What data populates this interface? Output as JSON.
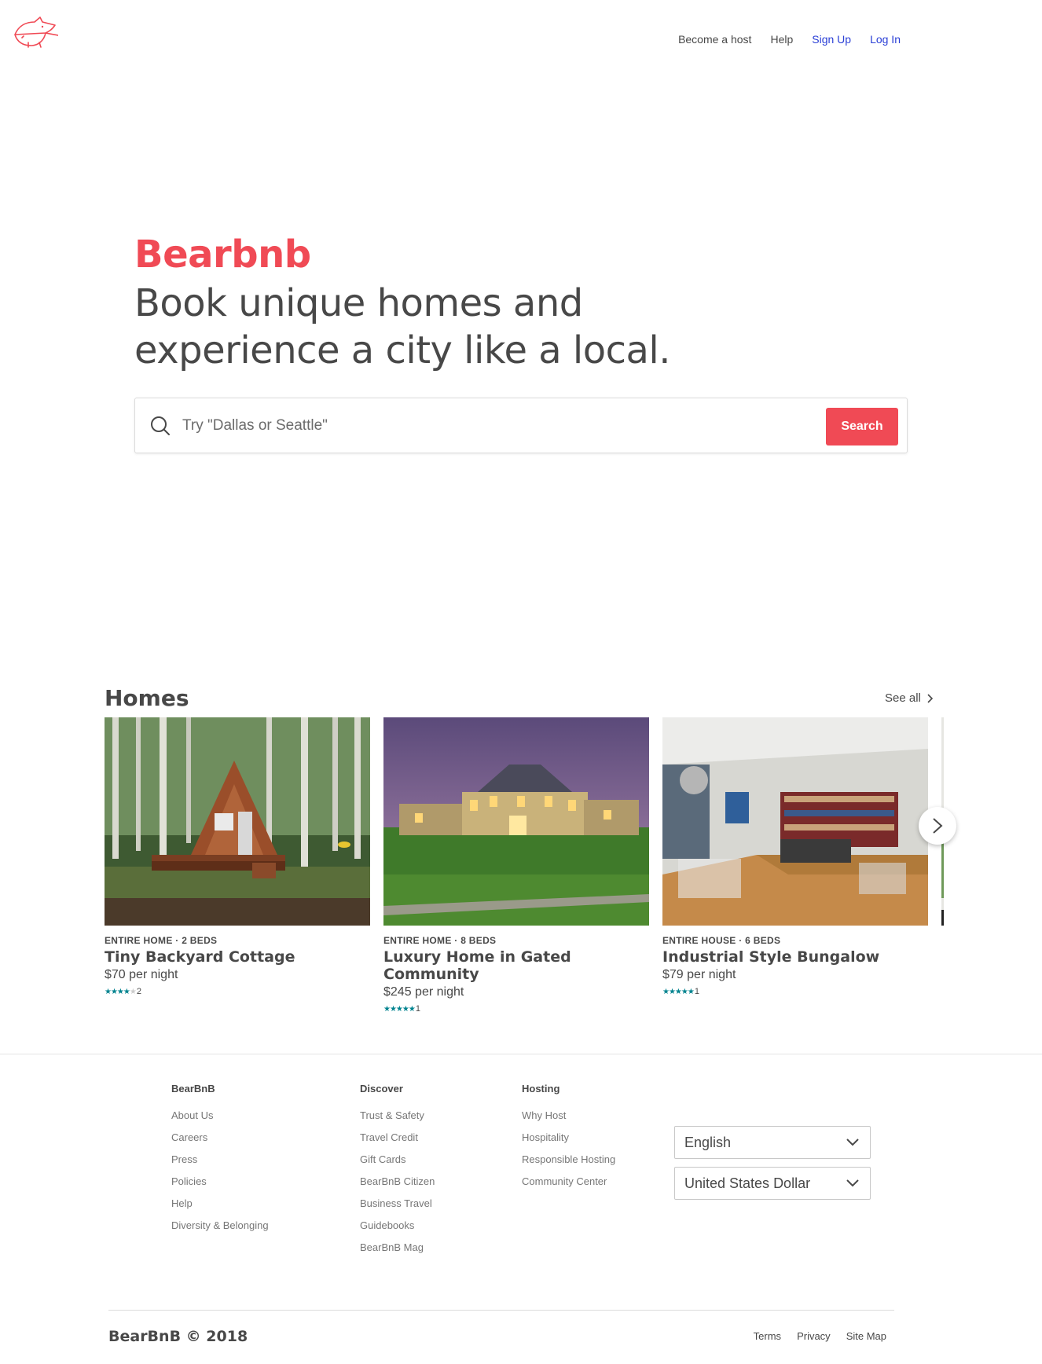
{
  "header": {
    "nav": {
      "become_host": "Become a host",
      "help": "Help",
      "sign_up": "Sign Up",
      "log_in": "Log In"
    }
  },
  "hero": {
    "brand": "Bearbnb",
    "tagline": "Book unique homes and experience a city like a local.",
    "search_placeholder": "Try \"Dallas or Seattle\"",
    "search_button": "Search"
  },
  "homes": {
    "title": "Homes",
    "see_all": "See all",
    "cards": [
      {
        "meta": "ENTIRE HOME · 2 BEDS",
        "title": "Tiny Backyard Cottage",
        "price": "$70 per night",
        "stars": 4,
        "reviews": "2"
      },
      {
        "meta": "ENTIRE HOME · 8 BEDS",
        "title": "Luxury Home in Gated Community",
        "price": "$245 per night",
        "stars": 5,
        "reviews": "1"
      },
      {
        "meta": "ENTIRE HOUSE · 6 BEDS",
        "title": "Industrial Style Bungalow",
        "price": "$79 per night",
        "stars": 5,
        "reviews": "1"
      }
    ]
  },
  "footer": {
    "col1": {
      "heading": "BearBnB",
      "links": [
        "About Us",
        "Careers",
        "Press",
        "Policies",
        "Help",
        "Diversity & Belonging"
      ]
    },
    "col2": {
      "heading": "Discover",
      "links": [
        "Trust & Safety",
        "Travel Credit",
        "Gift Cards",
        "BearBnB Citizen",
        "Business Travel",
        "Guidebooks",
        "BearBnB Mag"
      ]
    },
    "col3": {
      "heading": "Hosting",
      "links": [
        "Why Host",
        "Hospitality",
        "Responsible Hosting",
        "Community Center"
      ]
    },
    "language": "English",
    "currency": "United States Dollar",
    "copyright": "BearBnB © 2018",
    "legal": {
      "terms": "Terms",
      "privacy": "Privacy",
      "sitemap": "Site Map"
    }
  },
  "colors": {
    "brand": "#f04a55",
    "link_blue": "#2a3fd6",
    "star_teal": "#00838f"
  },
  "icons": [
    "bear-logo-icon",
    "search-icon",
    "chevron-right-icon",
    "chevron-down-icon",
    "star-icon"
  ]
}
